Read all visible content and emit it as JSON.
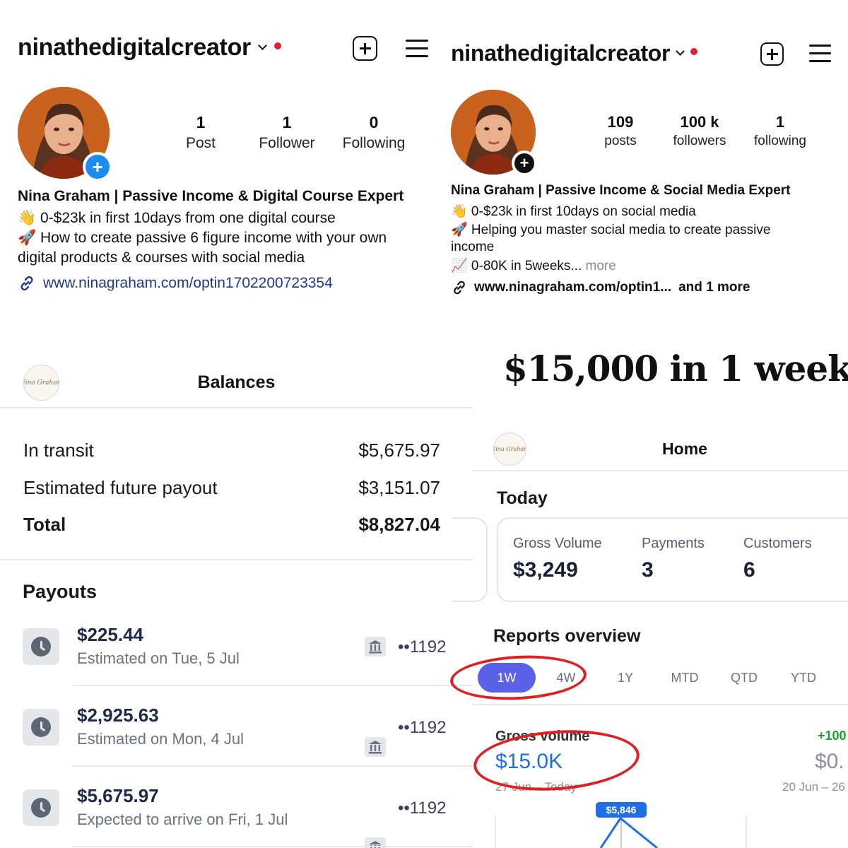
{
  "profile_left": {
    "username": "ninathedigitalcreator",
    "stats": [
      {
        "value": "1",
        "label": "Post"
      },
      {
        "value": "1",
        "label": "Follower"
      },
      {
        "value": "0",
        "label": "Following"
      }
    ],
    "bio_name": "Nina Graham | Passive Income & Digital Course Expert",
    "bio_lines": [
      "👋 0-$23k in first 10days from one digital course",
      "🚀 How to create passive 6 figure income with your own",
      "digital products & courses with social media"
    ],
    "link": "www.ninagraham.com/optin1702200723354",
    "add_badge_color": "#1d8cf0"
  },
  "profile_right": {
    "username": "ninathedigitalcreator",
    "stats": [
      {
        "value": "109",
        "label": "posts"
      },
      {
        "value": "100 k",
        "label": "followers"
      },
      {
        "value": "1",
        "label": "following"
      }
    ],
    "bio_name": "Nina Graham | Passive Income & Social Media Expert",
    "bio_lines": [
      "👋 0-$23k in first 10days on social media",
      "🚀 Helping you master social media to create passive",
      "income",
      "📈 0-80K in 5weeks..."
    ],
    "more_label": "more",
    "link": "www.ninagraham.com/optin1...",
    "link_more": "and 1 more",
    "add_badge_color": "#111111"
  },
  "balances": {
    "logo_text": "Nina Graham",
    "title": "Balances",
    "rows": [
      {
        "label": "In transit",
        "value": "$5,675.97"
      },
      {
        "label": "Estimated future payout",
        "value": "$3,151.07"
      }
    ],
    "total_label": "Total",
    "total_value": "$8,827.04",
    "payouts_title": "Payouts",
    "payouts": [
      {
        "amount": "$225.44",
        "sub": "Estimated on Tue, 5 Jul",
        "account": "••1192"
      },
      {
        "amount": "$2,925.63",
        "sub": "Estimated on Mon, 4 Jul",
        "account": "••1192"
      },
      {
        "amount": "$5,675.97",
        "sub": "Expected to arrive on Fri, 1 Jul",
        "account": "••1192"
      }
    ]
  },
  "headline": "$15,000 in 1 week",
  "home": {
    "logo_text": "Nina Graham",
    "title": "Home",
    "today_label": "Today",
    "metrics": [
      {
        "label": "Gross Volume",
        "value": "$3,249"
      },
      {
        "label": "Payments",
        "value": "3"
      },
      {
        "label": "Customers",
        "value": "6"
      }
    ],
    "reports_title": "Reports overview",
    "tabs": [
      "1W",
      "4W",
      "1Y",
      "MTD",
      "QTD",
      "YTD"
    ],
    "active_tab": "1W",
    "gross_label": "Gross volume",
    "gross_value": "$15.0K",
    "gross_range": "27 Jun – Today",
    "compare_pct": "+100",
    "compare_value": "$0.",
    "compare_range": "20 Jun – 26",
    "chart_peak_label": "$5,846",
    "accent_color": "#5b62e8",
    "link_color": "#1f6feb",
    "positive_color": "#1e9e3a",
    "annotation_color": "#e02020"
  }
}
